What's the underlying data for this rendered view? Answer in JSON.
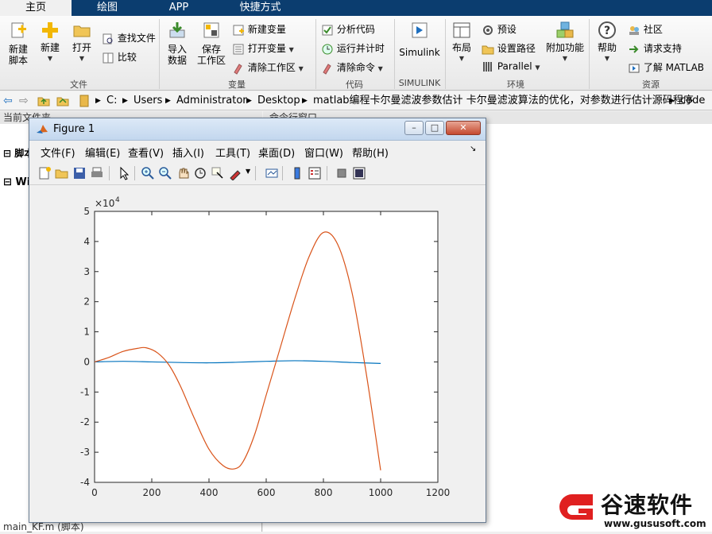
{
  "tabs": [
    {
      "label": "主页",
      "active": true
    },
    {
      "label": "绘图",
      "active": false
    },
    {
      "label": "APP",
      "active": false
    },
    {
      "label": "快捷方式",
      "active": false
    }
  ],
  "ribbon": {
    "file": {
      "new_script": "新建\n脚本",
      "new": "新建",
      "open": "打开",
      "find_files": "查找文件",
      "compare": "比较",
      "section": "文件"
    },
    "variable": {
      "import": "导入\n数据",
      "save_ws": "保存\n工作区",
      "new_var": "新建变量",
      "open_var": "打开变量",
      "clear_ws": "清除工作区",
      "section": "变量"
    },
    "code": {
      "analyze": "分析代码",
      "run_time": "运行并计时",
      "clear_cmd": "清除命令",
      "section": "代码"
    },
    "simulink": {
      "label": "Simulink",
      "section": "SIMULINK"
    },
    "environment": {
      "layout": "布局",
      "preferences": "预设",
      "set_path": "设置路径",
      "parallel": "Parallel",
      "addons": "附加功能",
      "section": "环境"
    },
    "resources": {
      "help": "帮助",
      "community": "社区",
      "support": "请求支持",
      "learn": "了解 MATLAB",
      "section": "资源"
    }
  },
  "address": {
    "segments": [
      "C:",
      "Users",
      "Administrator",
      "Desktop",
      "matlab编程卡尔曼滤波参数估计 卡尔曼滤波算法的优化，对参数进行估计源码程序",
      "code"
    ]
  },
  "panels": {
    "current_folder": "当前文件夹",
    "command_window": "命令行窗口",
    "left_items": [
      "脚本",
      "Wi"
    ],
    "bottom_file": "main_KF.m  (脚本)"
  },
  "figure": {
    "title": "Figure 1",
    "menu": [
      "文件(F)",
      "编辑(E)",
      "查看(V)",
      "插入(I)",
      "工具(T)",
      "桌面(D)",
      "窗口(W)",
      "帮助(H)"
    ]
  },
  "chart_data": {
    "type": "line",
    "title": "",
    "xlabel": "",
    "ylabel": "",
    "exponent_label": "×10",
    "exponent_power": "4",
    "xlim": [
      0,
      1200
    ],
    "ylim": [
      -4,
      5
    ],
    "xticks": [
      "0",
      "200",
      "400",
      "600",
      "800",
      "1000",
      "1200"
    ],
    "yticks": [
      "5",
      "4",
      "3",
      "2",
      "1",
      "0",
      "-1",
      "-2",
      "-3",
      "-4"
    ],
    "grid": false,
    "series": [
      {
        "color": "#0072bd",
        "x": [
          0,
          100,
          200,
          300,
          400,
          500,
          600,
          700,
          800,
          900,
          1000
        ],
        "y": [
          0.0,
          0.02,
          0.0,
          -0.02,
          -0.03,
          -0.01,
          0.02,
          0.04,
          0.02,
          -0.02,
          -0.05
        ]
      },
      {
        "color": "#d95319",
        "x": [
          0,
          50,
          100,
          150,
          180,
          220,
          260,
          300,
          350,
          400,
          450,
          490,
          520,
          560,
          600,
          650,
          700,
          750,
          800,
          850,
          900,
          950,
          1000
        ],
        "y": [
          0.0,
          0.15,
          0.35,
          0.45,
          0.47,
          0.3,
          -0.1,
          -0.8,
          -1.9,
          -2.9,
          -3.45,
          -3.55,
          -3.3,
          -2.4,
          -1.1,
          0.5,
          2.1,
          3.5,
          4.3,
          3.9,
          2.3,
          -0.4,
          -3.6
        ]
      }
    ]
  },
  "watermark": {
    "name": "谷速软件",
    "url": "www.gususoft.com",
    "color": "#e02020"
  }
}
